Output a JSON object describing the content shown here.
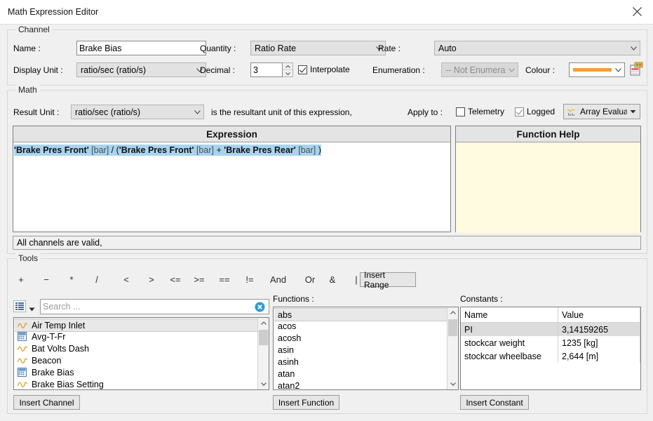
{
  "window": {
    "title": "Math Expression Editor",
    "close_icon": "close-icon"
  },
  "channel": {
    "legend": "Channel",
    "name_label": "Name :",
    "name_value": "Brake Bias",
    "quantity_label": "Quantity :",
    "quantity_value": "Ratio Rate",
    "rate_label": "Rate :",
    "rate_value": "Auto",
    "display_unit_label": "Display Unit :",
    "display_unit_value": "ratio/sec (ratio/s)",
    "decimal_label": "Decimal :",
    "decimal_value": "3",
    "interpolate_label": "Interpolate",
    "interpolate_checked": true,
    "enumeration_label": "Enumeration :",
    "enumeration_value": "-- Not Enumerated",
    "colour_label": "Colour :",
    "colour_swatch": "#f4a032",
    "palette_icon": "palette-icon"
  },
  "math": {
    "legend": "Math",
    "result_unit_label": "Result Unit :",
    "result_unit_value": "ratio/sec (ratio/s)",
    "result_unit_note": "is the resultant unit of this expression,",
    "apply_to_label": "Apply to :",
    "telemetry_label": "Telemetry",
    "telemetry_checked": false,
    "logged_label": "Logged",
    "logged_checked": true,
    "array_eval_label": "Array Evaluat",
    "array_eval_icon": "array-eval-icon"
  },
  "expression": {
    "header": "Expression",
    "tokens": [
      {
        "text": "'Brake Pres Front'",
        "kind": "channel"
      },
      {
        "text": " ",
        "kind": "op"
      },
      {
        "text": "[bar]",
        "kind": "unit"
      },
      {
        "text": "  / (",
        "kind": "op"
      },
      {
        "text": "'Brake Pres Front'",
        "kind": "channel"
      },
      {
        "text": " ",
        "kind": "op"
      },
      {
        "text": "[bar]",
        "kind": "unit"
      },
      {
        "text": "  + ",
        "kind": "op"
      },
      {
        "text": "'Brake Pres Rear'",
        "kind": "channel"
      },
      {
        "text": " ",
        "kind": "op"
      },
      {
        "text": "[bar]",
        "kind": "unit"
      },
      {
        "text": "  )",
        "kind": "op"
      }
    ],
    "plain": "'Brake Pres Front' [bar]  / ('Brake Pres Front' [bar]  + 'Brake Pres Rear' [bar]  )"
  },
  "function_help": {
    "header": "Function Help",
    "body": "",
    "background": "#fffbe0"
  },
  "status": {
    "message": "All channels are valid,"
  },
  "tools": {
    "legend": "Tools",
    "operators": [
      {
        "label": "+",
        "disabled": false
      },
      {
        "label": "−",
        "disabled": false
      },
      {
        "label": "*",
        "disabled": false
      },
      {
        "label": "/",
        "disabled": false
      },
      {
        "label": "<",
        "disabled": false
      },
      {
        "label": ">",
        "disabled": false
      },
      {
        "label": "<=",
        "disabled": false
      },
      {
        "label": ">=",
        "disabled": false
      },
      {
        "label": "==",
        "disabled": false
      },
      {
        "label": "!=",
        "disabled": false
      },
      {
        "label": "And",
        "disabled": false
      },
      {
        "label": "Or",
        "disabled": false
      },
      {
        "label": "&",
        "disabled": false
      },
      {
        "label": "|",
        "disabled": false
      },
      {
        "label": "()",
        "disabled": false
      },
      {
        "label": "[]",
        "disabled": true
      }
    ],
    "insert_range_label": "Insert Range"
  },
  "channels_panel": {
    "view_icon": "list-view-icon",
    "dropdown_icon": "chevron-down-icon",
    "search_placeholder": "Search ...",
    "search_value": "",
    "clear_icon": "clear-search-icon",
    "items": [
      {
        "label": "Air Temp Inlet",
        "icon": "waveform-icon",
        "selected": true
      },
      {
        "label": "Avg-T-Fr",
        "icon": "math-channel-icon",
        "selected": false
      },
      {
        "label": "Bat Volts Dash",
        "icon": "waveform-icon",
        "selected": false
      },
      {
        "label": "Beacon",
        "icon": "waveform-icon",
        "selected": false
      },
      {
        "label": "Brake Bias",
        "icon": "math-channel-icon",
        "selected": false
      },
      {
        "label": "Brake Bias Setting",
        "icon": "waveform-icon",
        "selected": false
      }
    ],
    "insert_button": "Insert Channel"
  },
  "functions_panel": {
    "label": "Functions :",
    "items": [
      {
        "label": "abs",
        "selected": true
      },
      {
        "label": "acos",
        "selected": false
      },
      {
        "label": "acosh",
        "selected": false
      },
      {
        "label": "asin",
        "selected": false
      },
      {
        "label": "asinh",
        "selected": false
      },
      {
        "label": "atan",
        "selected": false
      },
      {
        "label": "atan2",
        "selected": false
      }
    ],
    "insert_button": "Insert Function"
  },
  "constants_panel": {
    "label": "Constants :",
    "columns": [
      "Name",
      "Value"
    ],
    "rows": [
      {
        "name": "PI",
        "value": "3,14159265",
        "selected": true
      },
      {
        "name": "stockcar weight",
        "value": "1235 [kg]",
        "selected": false
      },
      {
        "name": "stockcar wheelbase",
        "value": "2,644 [m]",
        "selected": false
      }
    ],
    "insert_button": "Insert Constant"
  }
}
